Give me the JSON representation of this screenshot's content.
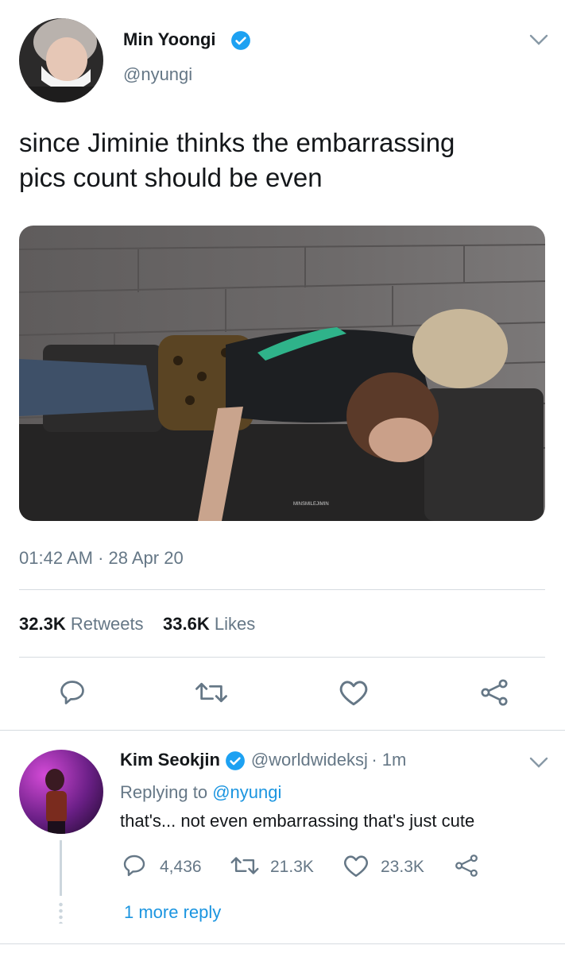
{
  "tweet": {
    "author_name": "Min Yoongi",
    "author_handle": "@nyungi",
    "text_line1": "since Jiminie thinks the embarrassing",
    "text_line2": "pics count should be even",
    "timestamp": "01:42 AM · 28 Apr 20",
    "retweets_count": "32.3K",
    "retweets_label": "Retweets",
    "likes_count": "33.6K",
    "likes_label": "Likes",
    "photo_watermark": "MINSMILEJIMIN"
  },
  "reply": {
    "author_name": "Kim Seokjin",
    "author_handle": "@worldwideksj",
    "time": "· 1m",
    "replying_prefix": "Replying to",
    "replying_to": "@nyungi",
    "text": "that's... not even embarrassing that's just cute",
    "reply_count": "4,436",
    "retweet_count": "21.3K",
    "like_count": "23.3K",
    "more_replies": "1 more reply"
  },
  "icons": [
    "chevron-down-icon",
    "verified-badge-icon",
    "reply-icon",
    "retweet-icon",
    "like-icon",
    "share-icon"
  ],
  "colors": {
    "accent": "#1da1f2",
    "link": "#1b95e0",
    "muted": "#657786",
    "text": "#14171a",
    "divider": "#d6dbe0"
  }
}
